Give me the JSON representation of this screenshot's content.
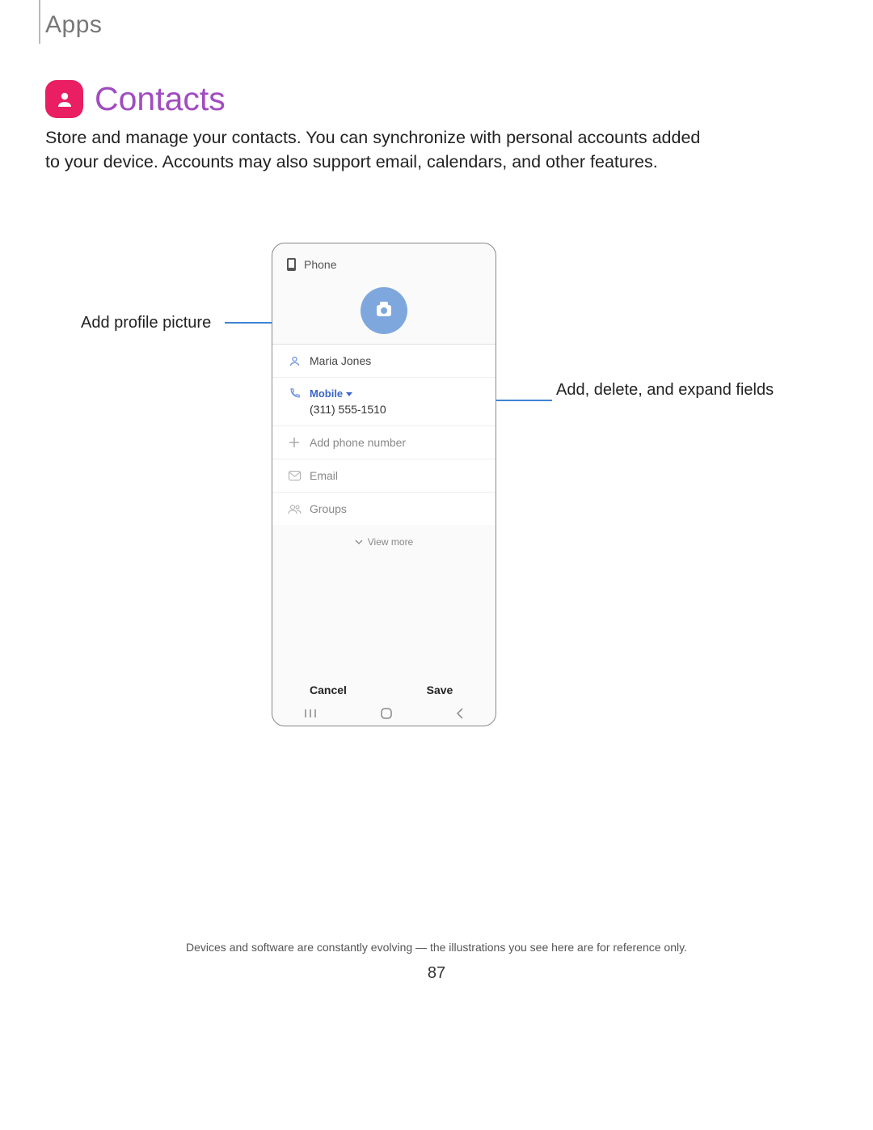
{
  "breadcrumb": "Apps",
  "heading": "Contacts",
  "description": "Store and manage your contacts. You can synchronize with personal accounts added to your device. Accounts may also support email, calendars, and other features.",
  "callouts": {
    "left": "Add profile picture",
    "right": "Add, delete, and expand fields"
  },
  "phone": {
    "storage_label": "Phone",
    "name_value": "Maria Jones",
    "phone_type": "Mobile",
    "phone_value": "(311) 555-1510",
    "add_phone": "Add phone number",
    "email_label": "Email",
    "groups_label": "Groups",
    "view_more": "View more",
    "cancel": "Cancel",
    "save": "Save"
  },
  "footnote": "Devices and software are constantly evolving — the illustrations you see here are for reference only.",
  "page_number": "87"
}
